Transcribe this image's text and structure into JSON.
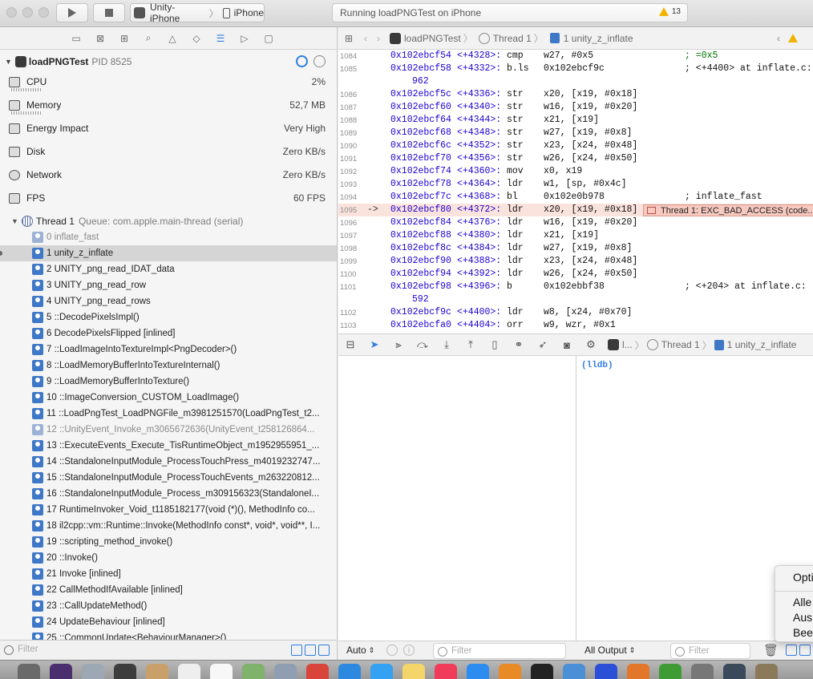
{
  "toolbar": {
    "scheme": "Unity-iPhone",
    "device": "iPhone",
    "activity": "Running loadPNGTest on iPhone",
    "warning_count": "13"
  },
  "navigator": {
    "process_name": "loadPNGTest",
    "process_pid": "PID 8525",
    "gauges": [
      {
        "label": "CPU",
        "value": "2%",
        "icon": "cpu-icon"
      },
      {
        "label": "Memory",
        "value": "52,7 MB",
        "icon": "memory-icon"
      },
      {
        "label": "Energy Impact",
        "value": "Very High",
        "icon": "energy-icon"
      },
      {
        "label": "Disk",
        "value": "Zero KB/s",
        "icon": "disk-icon"
      },
      {
        "label": "Network",
        "value": "Zero KB/s",
        "icon": "network-icon"
      },
      {
        "label": "FPS",
        "value": "60 FPS",
        "icon": "fps-icon"
      }
    ],
    "thread_label": "Thread 1",
    "thread_queue": "Queue: com.apple.main-thread (serial)",
    "frames": [
      "0 inflate_fast",
      "1 unity_z_inflate",
      "2 UNITY_png_read_IDAT_data",
      "3 UNITY_png_read_row",
      "4 UNITY_png_read_rows",
      "5 ::DecodePixelsImpl()",
      "6 DecodePixelsFlipped [inlined]",
      "7 ::LoadImageIntoTextureImpl<PngDecoder>()",
      "8 ::LoadMemoryBufferIntoTextureInternal()",
      "9 ::LoadMemoryBufferIntoTexture()",
      "10 ::ImageConversion_CUSTOM_LoadImage()",
      "11 ::LoadPngTest_LoadPNGFile_m3981251570(LoadPngTest_t2...",
      "12 ::UnityEvent_Invoke_m3065672636(UnityEvent_t258126864...",
      "13 ::ExecuteEvents_Execute_TisRuntimeObject_m1952955951_...",
      "14 ::StandaloneInputModule_ProcessTouchPress_m4019232747...",
      "15 ::StandaloneInputModule_ProcessTouchEvents_m263220812...",
      "16 ::StandaloneInputModule_Process_m309156323(StandaloneI...",
      "17 RuntimeInvoker_Void_t1185182177(void (*)(), MethodInfo co...",
      "18 il2cpp::vm::Runtime::Invoke(MethodInfo const*, void*, void**, I...",
      "19 ::scripting_method_invoke()",
      "20 ::Invoke()",
      "21 Invoke [inlined]",
      "22 CallMethodIfAvailable [inlined]",
      "23 ::CallUpdateMethod()",
      "24 UpdateBehaviour [inlined]",
      "25 ::CommonUpdate<BehaviourManager>()"
    ],
    "filter_placeholder": "Filter"
  },
  "jumpbar": {
    "project": "loadPNGTest",
    "thread": "Thread 1",
    "frame": "1 unity_z_inflate"
  },
  "code_lines": [
    {
      "ln": "1084",
      "addr": "0x102ebcf54",
      "off": "<+4328>:",
      "mn": "cmp",
      "ops": "w27, #0x5",
      "cm": "; =0x5"
    },
    {
      "ln": "1085",
      "addr": "0x102ebcf58",
      "off": "<+4332>:",
      "mn": "b.ls",
      "ops": "0x102ebcf9c",
      "cm": "; <+4400> at inflate.c:"
    },
    {
      "ln": "",
      "addr": "",
      "off": "",
      "mn": "",
      "ops": "962",
      "cm": ""
    },
    {
      "ln": "1086",
      "addr": "0x102ebcf5c",
      "off": "<+4336>:",
      "mn": "str",
      "ops": "x20, [x19, #0x18]",
      "cm": ""
    },
    {
      "ln": "1087",
      "addr": "0x102ebcf60",
      "off": "<+4340>:",
      "mn": "str",
      "ops": "w16, [x19, #0x20]",
      "cm": ""
    },
    {
      "ln": "1088",
      "addr": "0x102ebcf64",
      "off": "<+4344>:",
      "mn": "str",
      "ops": "x21, [x19]",
      "cm": ""
    },
    {
      "ln": "1089",
      "addr": "0x102ebcf68",
      "off": "<+4348>:",
      "mn": "str",
      "ops": "w27, [x19, #0x8]",
      "cm": ""
    },
    {
      "ln": "1090",
      "addr": "0x102ebcf6c",
      "off": "<+4352>:",
      "mn": "str",
      "ops": "x23, [x24, #0x48]",
      "cm": ""
    },
    {
      "ln": "1091",
      "addr": "0x102ebcf70",
      "off": "<+4356>:",
      "mn": "str",
      "ops": "w26, [x24, #0x50]",
      "cm": ""
    },
    {
      "ln": "1092",
      "addr": "0x102ebcf74",
      "off": "<+4360>:",
      "mn": "mov",
      "ops": "x0, x19",
      "cm": ""
    },
    {
      "ln": "1093",
      "addr": "0x102ebcf78",
      "off": "<+4364>:",
      "mn": "ldr",
      "ops": "w1, [sp, #0x4c]",
      "cm": ""
    },
    {
      "ln": "1094",
      "addr": "0x102ebcf7c",
      "off": "<+4368>:",
      "mn": "bl",
      "ops": "0x102e0b978",
      "cm": "; inflate_fast"
    },
    {
      "ln": "1095",
      "addr": "0x102ebcf80",
      "off": "<+4372>:",
      "mn": "ldr",
      "ops": "x20, [x19, #0x18]",
      "cm": "",
      "arrow": "->"
    },
    {
      "ln": "1096",
      "addr": "0x102ebcf84",
      "off": "<+4376>:",
      "mn": "ldr",
      "ops": "w16, [x19, #0x20]",
      "cm": ""
    },
    {
      "ln": "1097",
      "addr": "0x102ebcf88",
      "off": "<+4380>:",
      "mn": "ldr",
      "ops": "x21, [x19]",
      "cm": ""
    },
    {
      "ln": "1098",
      "addr": "0x102ebcf8c",
      "off": "<+4384>:",
      "mn": "ldr",
      "ops": "w27, [x19, #0x8]",
      "cm": ""
    },
    {
      "ln": "1099",
      "addr": "0x102ebcf90",
      "off": "<+4388>:",
      "mn": "ldr",
      "ops": "x23, [x24, #0x48]",
      "cm": ""
    },
    {
      "ln": "1100",
      "addr": "0x102ebcf94",
      "off": "<+4392>:",
      "mn": "ldr",
      "ops": "w26, [x24, #0x50]",
      "cm": ""
    },
    {
      "ln": "1101",
      "addr": "0x102ebcf98",
      "off": "<+4396>:",
      "mn": "b",
      "ops": "0x102ebbf38",
      "cm": "; <+204> at inflate.c:"
    },
    {
      "ln": "",
      "addr": "",
      "off": "",
      "mn": "",
      "ops": "592",
      "cm": ""
    },
    {
      "ln": "1102",
      "addr": "0x102ebcf9c",
      "off": "<+4400>:",
      "mn": "ldr",
      "ops": "w8, [x24, #0x70]",
      "cm": ""
    },
    {
      "ln": "1103",
      "addr": "0x102ebcfa0",
      "off": "<+4404>:",
      "mn": "orr",
      "ops": "w9, wzr, #0x1",
      "cm": ""
    }
  ],
  "exception_badge": "Thread 1: EXC_BAD_ACCESS (code...",
  "debugbar": {
    "process_short": "l...",
    "thread": "Thread 1",
    "frame": "1 unity_z_inflate"
  },
  "console": {
    "prompt": "(lldb)"
  },
  "bottombar": {
    "vars_scope": "Auto",
    "vars_filter_placeholder": "Filter",
    "output_scope": "All Output",
    "console_filter_placeholder": "Filter"
  },
  "popup_menu": {
    "items": [
      "Opti",
      "Alle",
      "Ausl",
      "Bee"
    ]
  },
  "colors": {
    "accent": "#2f7de1",
    "exception_highlight": "#fbe3dd",
    "exception_badge": "#f7c9bf",
    "address": "#1c00cf",
    "comment_green": "#007400"
  }
}
